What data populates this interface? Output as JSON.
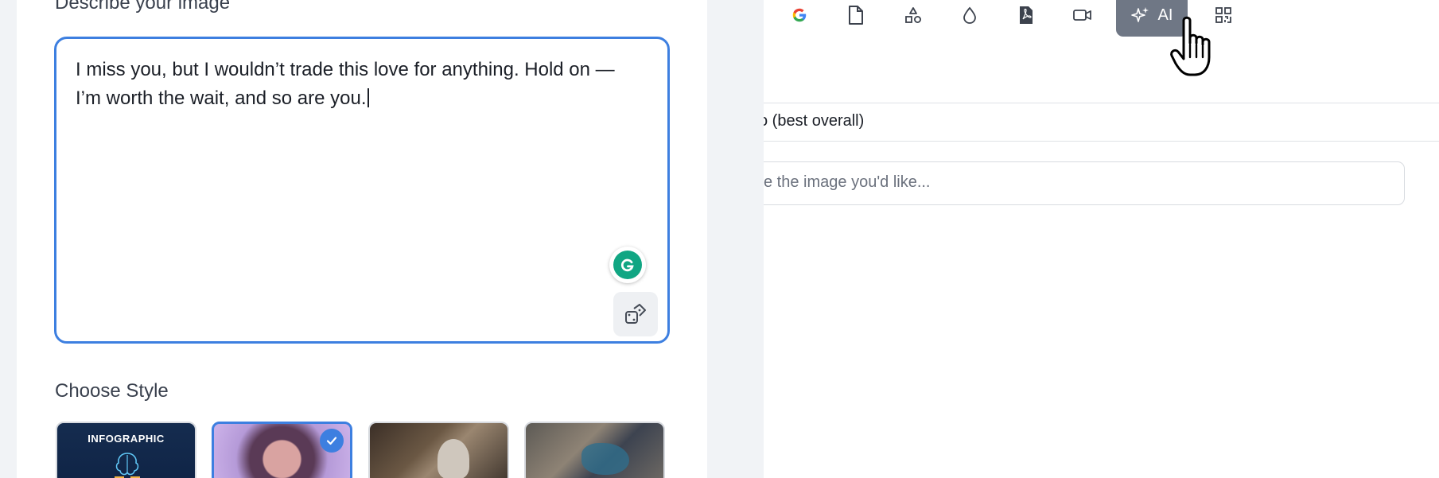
{
  "left": {
    "describe_label": "Describe your image",
    "prompt_text": "I miss you, but I wouldn’t trade this love for anything. Hold on — I’m worth the wait, and so are you.",
    "choose_style_label": "Choose Style",
    "styles": [
      {
        "label": "INFOGRAPHIC",
        "selected": false
      },
      {
        "label": "",
        "selected": true
      },
      {
        "label": "",
        "selected": false
      },
      {
        "label": "",
        "selected": false
      }
    ]
  },
  "right": {
    "toolbar_icons": [
      "google-icon",
      "file-icon",
      "shapes-icon",
      "drop-icon",
      "pdf-icon",
      "video-icon",
      "sparkle-icon",
      "qr-code-icon"
    ],
    "ai_button_label": "AI",
    "model_text": "o (best overall)",
    "prompt_placeholder": "e the image you'd like..."
  },
  "colors": {
    "accent": "#3d7fe0",
    "ai_button_bg": "#6f7785",
    "grammarly": "#11a683"
  }
}
